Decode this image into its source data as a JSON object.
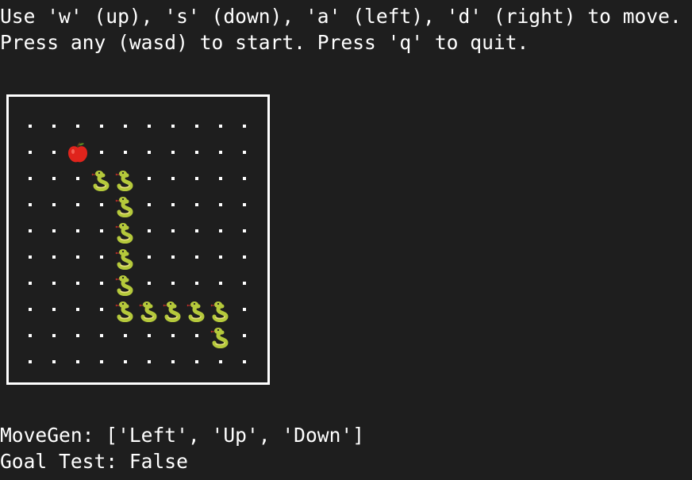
{
  "instructions": {
    "line1": "Use 'w' (up), 's' (down), 'a' (left), 'd' (right) to move.",
    "line2": "Press any (wasd) to start. Press 'q' to quit."
  },
  "board": {
    "rows": 10,
    "cols": 10,
    "empty_symbol": ".",
    "apple": [
      1,
      2
    ],
    "snake": [
      [
        2,
        3
      ],
      [
        2,
        4
      ],
      [
        3,
        4
      ],
      [
        4,
        4
      ],
      [
        5,
        4
      ],
      [
        6,
        4
      ],
      [
        7,
        4
      ],
      [
        7,
        5
      ],
      [
        7,
        6
      ],
      [
        7,
        7
      ],
      [
        7,
        8
      ],
      [
        8,
        8
      ]
    ],
    "colors": {
      "apple_body": "#e0241c",
      "apple_leaf": "#5a8a22",
      "snake_body": "#b5c93b",
      "snake_belly": "#e8e07a",
      "snake_tongue": "#d0302a"
    }
  },
  "status": {
    "movegen": "MoveGen: ['Left', 'Up', 'Down']",
    "goal_test": "Goal Test: False"
  },
  "colors": {
    "background": "#1e1e1e",
    "text": "#ffffff"
  }
}
